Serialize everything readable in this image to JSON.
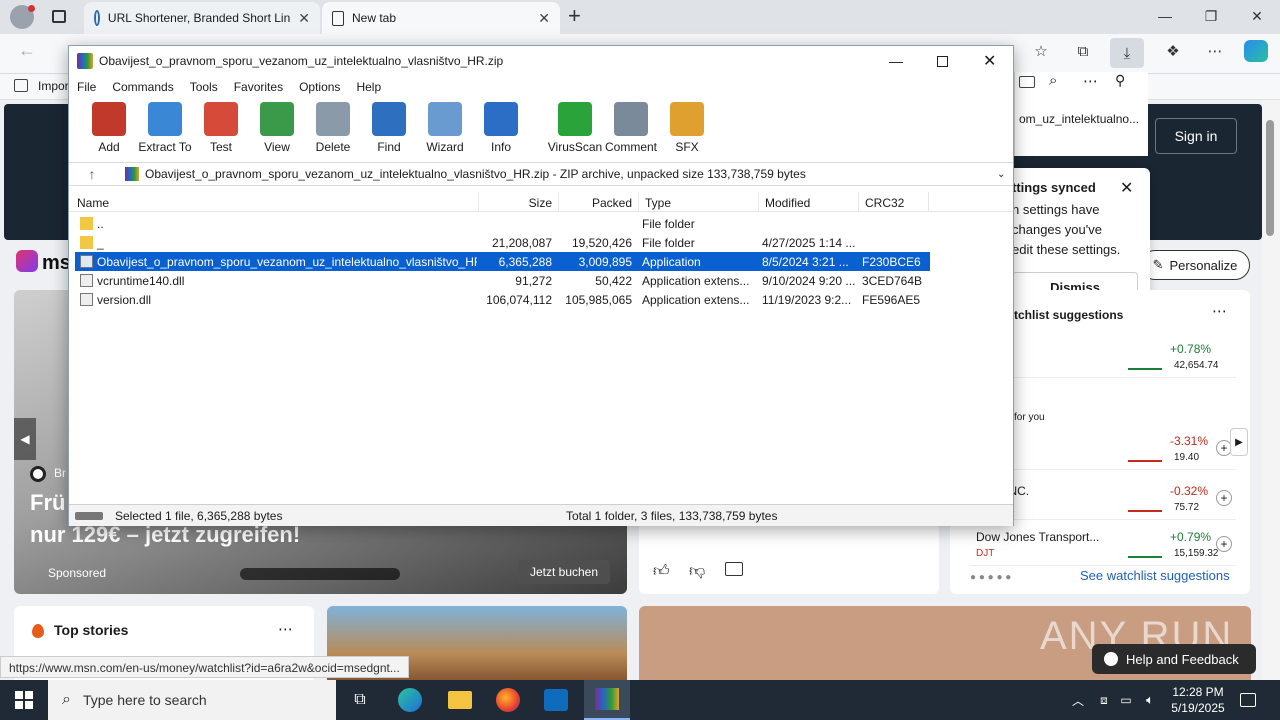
{
  "browser": {
    "tabs": [
      {
        "label": "URL Shortener, Branded Short Lin"
      },
      {
        "label": "New tab"
      }
    ],
    "favorites_bar": {
      "first_item": "Impor"
    },
    "status_url": "https://www.msn.com/en-us/money/watchlist?id=a6ra2w&ocid=msedgnt..."
  },
  "msn": {
    "logo": "ms",
    "sign_in": "Sign in",
    "sidebar_text": "om_uz_intelektualno...",
    "settings_popup": {
      "title": "ttings synced",
      "line1": "n settings have",
      "line2": "changes you've",
      "line3": "edit these settings.",
      "dismiss": "Dismiss"
    },
    "personalize": "Personalize",
    "ad": {
      "brand": "Br",
      "headline1": "Frü",
      "headline2": "nur 129€ – jetzt zugreifen!",
      "sponsored": "Sponsored",
      "cta": "Jetzt buchen"
    },
    "watchlist": {
      "header": "tchlist suggestions",
      "for_you": "for you",
      "rows": [
        {
          "name": "",
          "sub": "",
          "change": "+0.78%",
          "price": "42,654.74",
          "color": "#1a7f37"
        },
        {
          "name": "",
          "sub": "g fast",
          "change": "-3.31%",
          "price": "19.40",
          "color": "#c42b1c"
        },
        {
          "name": "OUP INC.",
          "sub": "",
          "change": "-0.32%",
          "price": "75.72",
          "color": "#c42b1c"
        },
        {
          "name": "Dow Jones Transport...",
          "sub": "DJT",
          "change": "+0.79%",
          "price": "15,159.32",
          "color": "#1a7f37"
        }
      ],
      "see_more": "See watchlist suggestions"
    },
    "top_stories": "Top stories",
    "help": "Help and Feedback",
    "watermark": "ANY RUN"
  },
  "winrar": {
    "title": "Obavijest_o_pravnom_sporu_vezanom_uz_intelektualno_vlasništvo_HR.zip",
    "menu": [
      "File",
      "Commands",
      "Tools",
      "Favorites",
      "Options",
      "Help"
    ],
    "tools": [
      {
        "label": "Add",
        "color": "#c0392b"
      },
      {
        "label": "Extract To",
        "color": "#3a87d6"
      },
      {
        "label": "Test",
        "color": "#d64a3a"
      },
      {
        "label": "View",
        "color": "#3a9a4a"
      },
      {
        "label": "Delete",
        "color": "#8a9aa8"
      },
      {
        "label": "Find",
        "color": "#2f6fc0"
      },
      {
        "label": "Wizard",
        "color": "#6a9bd0"
      },
      {
        "label": "Info",
        "color": "#2c6ec6"
      },
      {
        "label": "VirusScan",
        "color": "#2aa33a"
      },
      {
        "label": "Comment",
        "color": "#7a8a9a"
      },
      {
        "label": "SFX",
        "color": "#e0a030"
      }
    ],
    "path": "Obavijest_o_pravnom_sporu_vezanom_uz_intelektualno_vlasništvo_HR.zip - ZIP archive, unpacked size 133,738,759 bytes",
    "columns": [
      "Name",
      "Size",
      "Packed",
      "Type",
      "Modified",
      "CRC32"
    ],
    "rows": [
      {
        "name": "..",
        "size": "",
        "packed": "",
        "type": "File folder",
        "modified": "",
        "crc": "",
        "icon": "folder",
        "selected": false
      },
      {
        "name": "_",
        "size": "21,208,087",
        "packed": "19,520,426",
        "type": "File folder",
        "modified": "4/27/2025 1:14 ...",
        "crc": "",
        "icon": "folder",
        "selected": false
      },
      {
        "name": "Obavijest_o_pravnom_sporu_vezanom_uz_intelektualno_vlasništvo_HR....",
        "size": "6,365,288",
        "packed": "3,009,895",
        "type": "Application",
        "modified": "8/5/2024 3:21 ...",
        "crc": "F230BCE6",
        "icon": "app",
        "selected": true
      },
      {
        "name": "vcruntime140.dll",
        "size": "91,272",
        "packed": "50,422",
        "type": "Application extens...",
        "modified": "9/10/2024 9:20 ...",
        "crc": "3CED764B",
        "icon": "dll",
        "selected": false
      },
      {
        "name": "version.dll",
        "size": "106,074,112",
        "packed": "105,985,065",
        "type": "Application extens...",
        "modified": "11/19/2023 9:2...",
        "crc": "FE596AE5",
        "icon": "dll",
        "selected": false
      }
    ],
    "status_left": "Selected 1 file, 6,365,288 bytes",
    "status_right": "Total 1 folder, 3 files, 133,738,759 bytes"
  },
  "taskbar": {
    "search_placeholder": "Type here to search",
    "time": "12:28 PM",
    "date": "5/19/2025"
  }
}
